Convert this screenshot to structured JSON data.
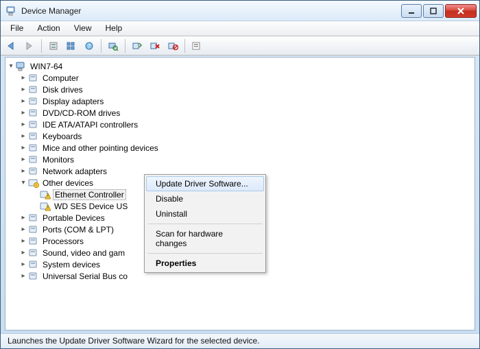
{
  "window": {
    "title": "Device Manager"
  },
  "menubar": {
    "file": "File",
    "action": "Action",
    "view": "View",
    "help": "Help"
  },
  "tree": {
    "root": "WIN7-64",
    "items": [
      "Computer",
      "Disk drives",
      "Display adapters",
      "DVD/CD-ROM drives",
      "IDE ATA/ATAPI controllers",
      "Keyboards",
      "Mice and other pointing devices",
      "Monitors",
      "Network adapters"
    ],
    "other_devices": {
      "label": "Other devices",
      "children": [
        "Ethernet Controller",
        "WD SES Device US"
      ]
    },
    "tail": [
      "Portable Devices",
      "Ports (COM & LPT)",
      "Processors",
      "Sound, video and gam",
      "System devices",
      "Universal Serial Bus co"
    ]
  },
  "contextmenu": {
    "update": "Update Driver Software...",
    "disable": "Disable",
    "uninstall": "Uninstall",
    "scan": "Scan for hardware changes",
    "properties": "Properties"
  },
  "statusbar": {
    "text": "Launches the Update Driver Software Wizard for the selected device."
  }
}
